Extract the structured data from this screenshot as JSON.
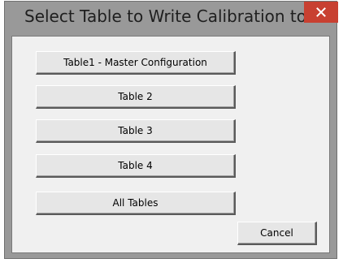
{
  "window": {
    "title": "Select Table to Write Calibration to:",
    "close_glyph": "✕"
  },
  "buttons": [
    {
      "label": "Table1 - Master Configuration"
    },
    {
      "label": "Table 2"
    },
    {
      "label": "Table 3"
    },
    {
      "label": "Table 4"
    },
    {
      "label": "All Tables"
    }
  ],
  "cancel": {
    "label": "Cancel"
  },
  "colors": {
    "titlebar": "#999999",
    "close_button": "#c84031",
    "client_background": "#f0f0f0"
  }
}
